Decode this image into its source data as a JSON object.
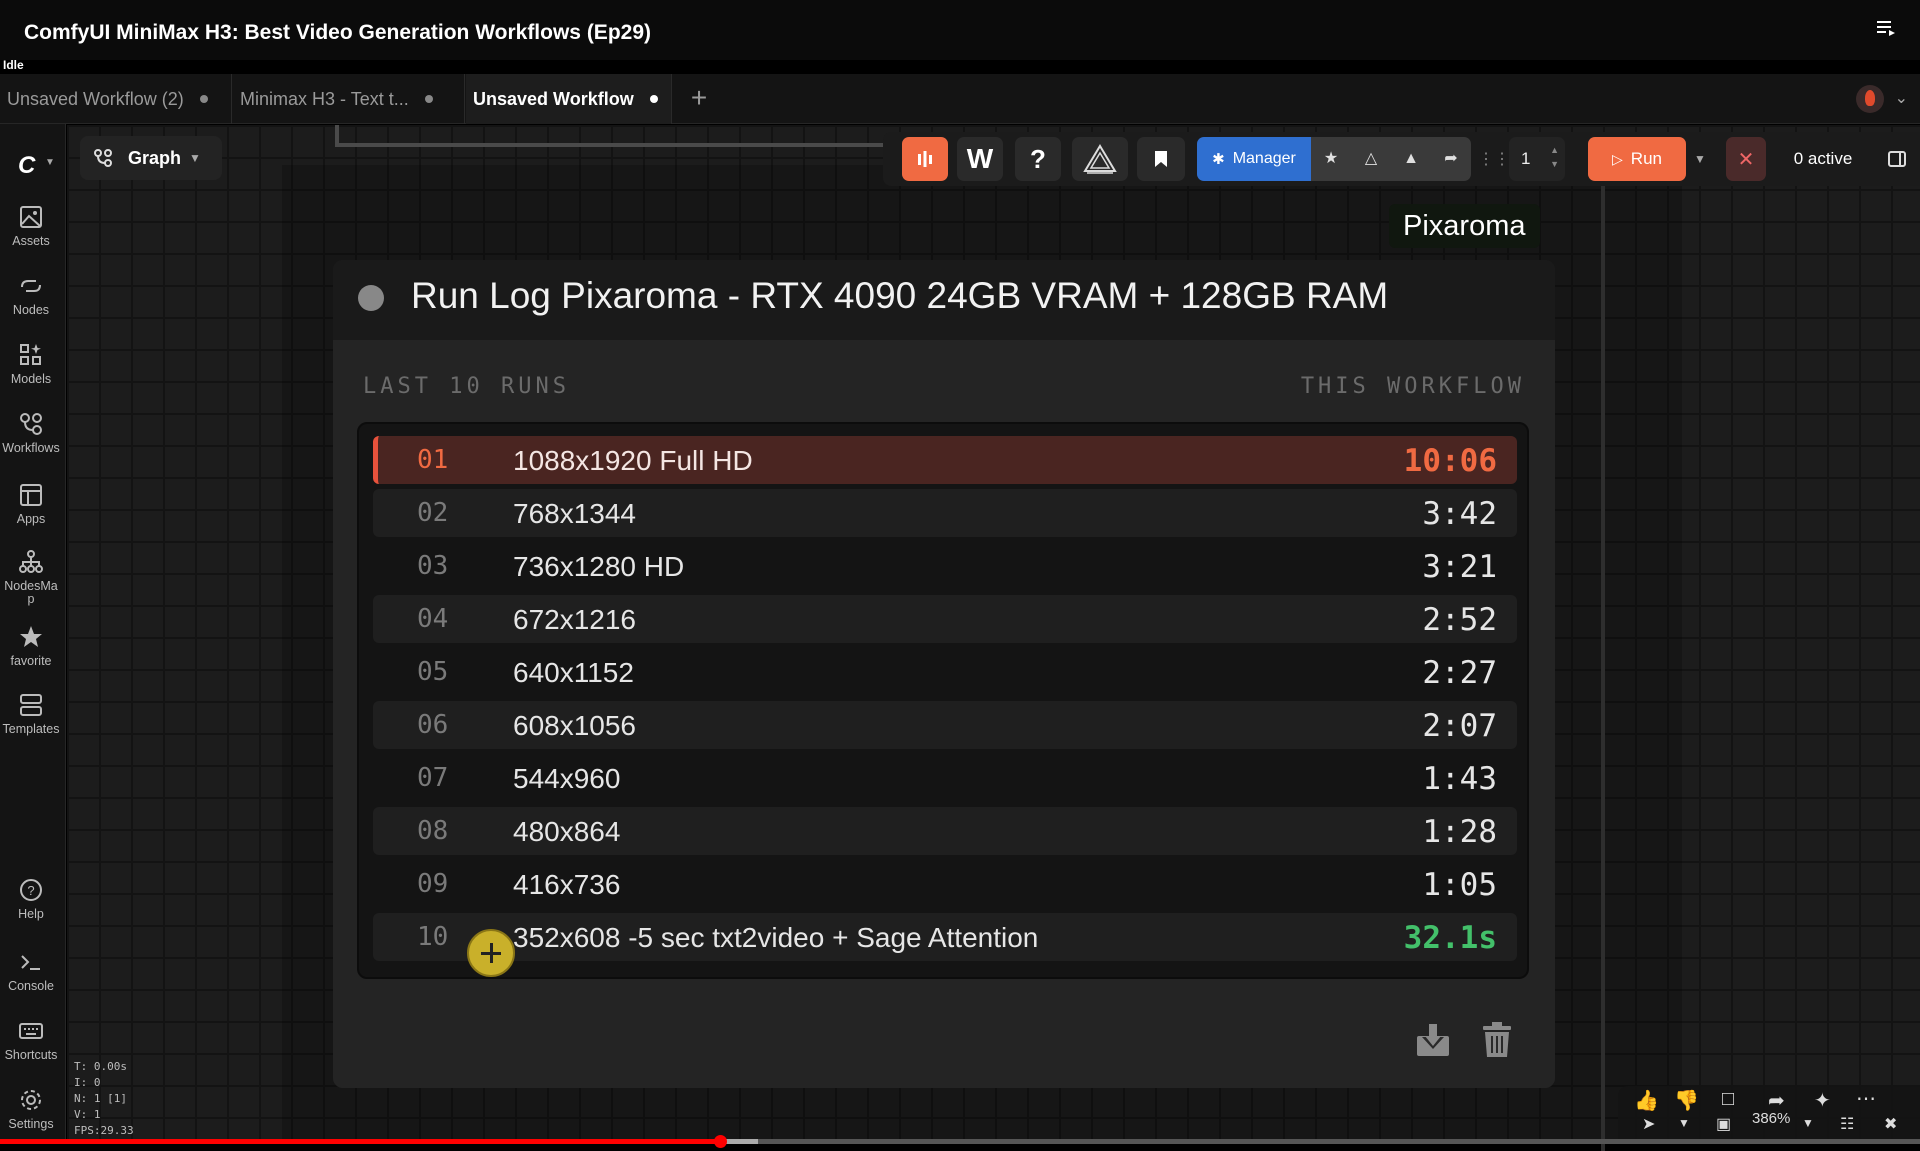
{
  "video": {
    "title": "ComfyUI MiniMax H3: Best Video Generation Workflows (Ep29)",
    "status": "Idle",
    "progress": 0.375
  },
  "tabs": [
    {
      "label": "Unsaved Workflow (2)",
      "active": false
    },
    {
      "label": "Minimax H3 - Text t...",
      "active": false
    },
    {
      "label": "Unsaved Workflow",
      "active": true
    }
  ],
  "sidebar": {
    "items": [
      {
        "label": "Assets",
        "icon": "image-icon"
      },
      {
        "label": "Nodes",
        "icon": "node-icon"
      },
      {
        "label": "Models",
        "icon": "models-icon"
      },
      {
        "label": "Workflows",
        "icon": "workflow-icon"
      },
      {
        "label": "Apps",
        "icon": "apps-icon"
      },
      {
        "label": "NodesMa\np",
        "icon": "nodesmap-icon"
      },
      {
        "label": "favorite",
        "icon": "star-icon"
      },
      {
        "label": "Templates",
        "icon": "templates-icon"
      }
    ],
    "bottom_items": [
      {
        "label": "Help",
        "icon": "help-icon"
      },
      {
        "label": "Console",
        "icon": "console-icon"
      },
      {
        "label": "Shortcuts",
        "icon": "keyboard-icon"
      },
      {
        "label": "Settings",
        "icon": "gear-icon"
      }
    ]
  },
  "perf": {
    "t": "T: 0.00s",
    "i": "I: 0",
    "n": "N: 1 [1]",
    "v": "V: 1",
    "fps": "FPS:29.33"
  },
  "graph": {
    "label": "Graph"
  },
  "toolbar": {
    "w_label": "W",
    "help_label": "?",
    "manager_label": "Manager",
    "queue_count": "1",
    "run_label": "Run",
    "active_label": "0 active"
  },
  "brand_tag": "Pixaroma",
  "run_log": {
    "title": "Run Log Pixaroma - RTX 4090 24GB VRAM + 128GB RAM",
    "left_label": "LAST 10 RUNS",
    "right_label": "THIS WORKFLOW",
    "runs": [
      {
        "idx": "01",
        "resolution": "1088x1920 Full HD",
        "time": "10:06",
        "style": "highlight"
      },
      {
        "idx": "02",
        "resolution": "768x1344",
        "time": "3:42",
        "style": "even"
      },
      {
        "idx": "03",
        "resolution": "736x1280 HD",
        "time": "3:21",
        "style": "odd"
      },
      {
        "idx": "04",
        "resolution": "672x1216",
        "time": "2:52",
        "style": "even"
      },
      {
        "idx": "05",
        "resolution": "640x1152",
        "time": "2:27",
        "style": "odd"
      },
      {
        "idx": "06",
        "resolution": "608x1056",
        "time": "2:07",
        "style": "even"
      },
      {
        "idx": "07",
        "resolution": "544x960",
        "time": "1:43",
        "style": "odd"
      },
      {
        "idx": "08",
        "resolution": "480x864",
        "time": "1:28",
        "style": "even"
      },
      {
        "idx": "09",
        "resolution": "416x736",
        "time": "1:05",
        "style": "odd"
      },
      {
        "idx": "10",
        "resolution": "352x608 -5 sec txt2video + Sage Attention",
        "time": "32.1s",
        "style": "fast"
      }
    ]
  },
  "canvas_controls": {
    "zoom": "386%"
  },
  "colors": {
    "accent": "#f06a42",
    "manager": "#2f6fd0",
    "fast": "#43c06a"
  }
}
